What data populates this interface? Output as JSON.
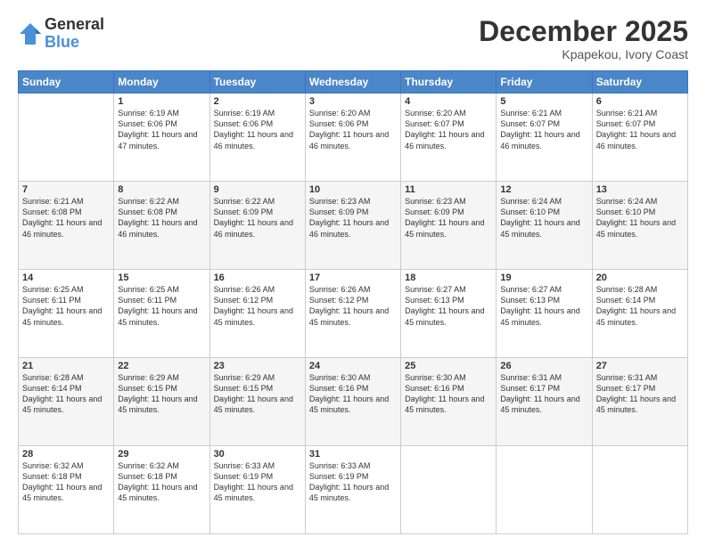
{
  "header": {
    "logo_general": "General",
    "logo_blue": "Blue",
    "month_title": "December 2025",
    "subtitle": "Kpapekou, Ivory Coast"
  },
  "days_of_week": [
    "Sunday",
    "Monday",
    "Tuesday",
    "Wednesday",
    "Thursday",
    "Friday",
    "Saturday"
  ],
  "weeks": [
    [
      {
        "day": "",
        "info": ""
      },
      {
        "day": "1",
        "info": "Sunrise: 6:19 AM\nSunset: 6:06 PM\nDaylight: 11 hours and 47 minutes."
      },
      {
        "day": "2",
        "info": "Sunrise: 6:19 AM\nSunset: 6:06 PM\nDaylight: 11 hours and 46 minutes."
      },
      {
        "day": "3",
        "info": "Sunrise: 6:20 AM\nSunset: 6:06 PM\nDaylight: 11 hours and 46 minutes."
      },
      {
        "day": "4",
        "info": "Sunrise: 6:20 AM\nSunset: 6:07 PM\nDaylight: 11 hours and 46 minutes."
      },
      {
        "day": "5",
        "info": "Sunrise: 6:21 AM\nSunset: 6:07 PM\nDaylight: 11 hours and 46 minutes."
      },
      {
        "day": "6",
        "info": "Sunrise: 6:21 AM\nSunset: 6:07 PM\nDaylight: 11 hours and 46 minutes."
      }
    ],
    [
      {
        "day": "7",
        "info": "Sunrise: 6:21 AM\nSunset: 6:08 PM\nDaylight: 11 hours and 46 minutes."
      },
      {
        "day": "8",
        "info": "Sunrise: 6:22 AM\nSunset: 6:08 PM\nDaylight: 11 hours and 46 minutes."
      },
      {
        "day": "9",
        "info": "Sunrise: 6:22 AM\nSunset: 6:09 PM\nDaylight: 11 hours and 46 minutes."
      },
      {
        "day": "10",
        "info": "Sunrise: 6:23 AM\nSunset: 6:09 PM\nDaylight: 11 hours and 46 minutes."
      },
      {
        "day": "11",
        "info": "Sunrise: 6:23 AM\nSunset: 6:09 PM\nDaylight: 11 hours and 45 minutes."
      },
      {
        "day": "12",
        "info": "Sunrise: 6:24 AM\nSunset: 6:10 PM\nDaylight: 11 hours and 45 minutes."
      },
      {
        "day": "13",
        "info": "Sunrise: 6:24 AM\nSunset: 6:10 PM\nDaylight: 11 hours and 45 minutes."
      }
    ],
    [
      {
        "day": "14",
        "info": "Sunrise: 6:25 AM\nSunset: 6:11 PM\nDaylight: 11 hours and 45 minutes."
      },
      {
        "day": "15",
        "info": "Sunrise: 6:25 AM\nSunset: 6:11 PM\nDaylight: 11 hours and 45 minutes."
      },
      {
        "day": "16",
        "info": "Sunrise: 6:26 AM\nSunset: 6:12 PM\nDaylight: 11 hours and 45 minutes."
      },
      {
        "day": "17",
        "info": "Sunrise: 6:26 AM\nSunset: 6:12 PM\nDaylight: 11 hours and 45 minutes."
      },
      {
        "day": "18",
        "info": "Sunrise: 6:27 AM\nSunset: 6:13 PM\nDaylight: 11 hours and 45 minutes."
      },
      {
        "day": "19",
        "info": "Sunrise: 6:27 AM\nSunset: 6:13 PM\nDaylight: 11 hours and 45 minutes."
      },
      {
        "day": "20",
        "info": "Sunrise: 6:28 AM\nSunset: 6:14 PM\nDaylight: 11 hours and 45 minutes."
      }
    ],
    [
      {
        "day": "21",
        "info": "Sunrise: 6:28 AM\nSunset: 6:14 PM\nDaylight: 11 hours and 45 minutes."
      },
      {
        "day": "22",
        "info": "Sunrise: 6:29 AM\nSunset: 6:15 PM\nDaylight: 11 hours and 45 minutes."
      },
      {
        "day": "23",
        "info": "Sunrise: 6:29 AM\nSunset: 6:15 PM\nDaylight: 11 hours and 45 minutes."
      },
      {
        "day": "24",
        "info": "Sunrise: 6:30 AM\nSunset: 6:16 PM\nDaylight: 11 hours and 45 minutes."
      },
      {
        "day": "25",
        "info": "Sunrise: 6:30 AM\nSunset: 6:16 PM\nDaylight: 11 hours and 45 minutes."
      },
      {
        "day": "26",
        "info": "Sunrise: 6:31 AM\nSunset: 6:17 PM\nDaylight: 11 hours and 45 minutes."
      },
      {
        "day": "27",
        "info": "Sunrise: 6:31 AM\nSunset: 6:17 PM\nDaylight: 11 hours and 45 minutes."
      }
    ],
    [
      {
        "day": "28",
        "info": "Sunrise: 6:32 AM\nSunset: 6:18 PM\nDaylight: 11 hours and 45 minutes."
      },
      {
        "day": "29",
        "info": "Sunrise: 6:32 AM\nSunset: 6:18 PM\nDaylight: 11 hours and 45 minutes."
      },
      {
        "day": "30",
        "info": "Sunrise: 6:33 AM\nSunset: 6:19 PM\nDaylight: 11 hours and 45 minutes."
      },
      {
        "day": "31",
        "info": "Sunrise: 6:33 AM\nSunset: 6:19 PM\nDaylight: 11 hours and 45 minutes."
      },
      {
        "day": "",
        "info": ""
      },
      {
        "day": "",
        "info": ""
      },
      {
        "day": "",
        "info": ""
      }
    ]
  ]
}
